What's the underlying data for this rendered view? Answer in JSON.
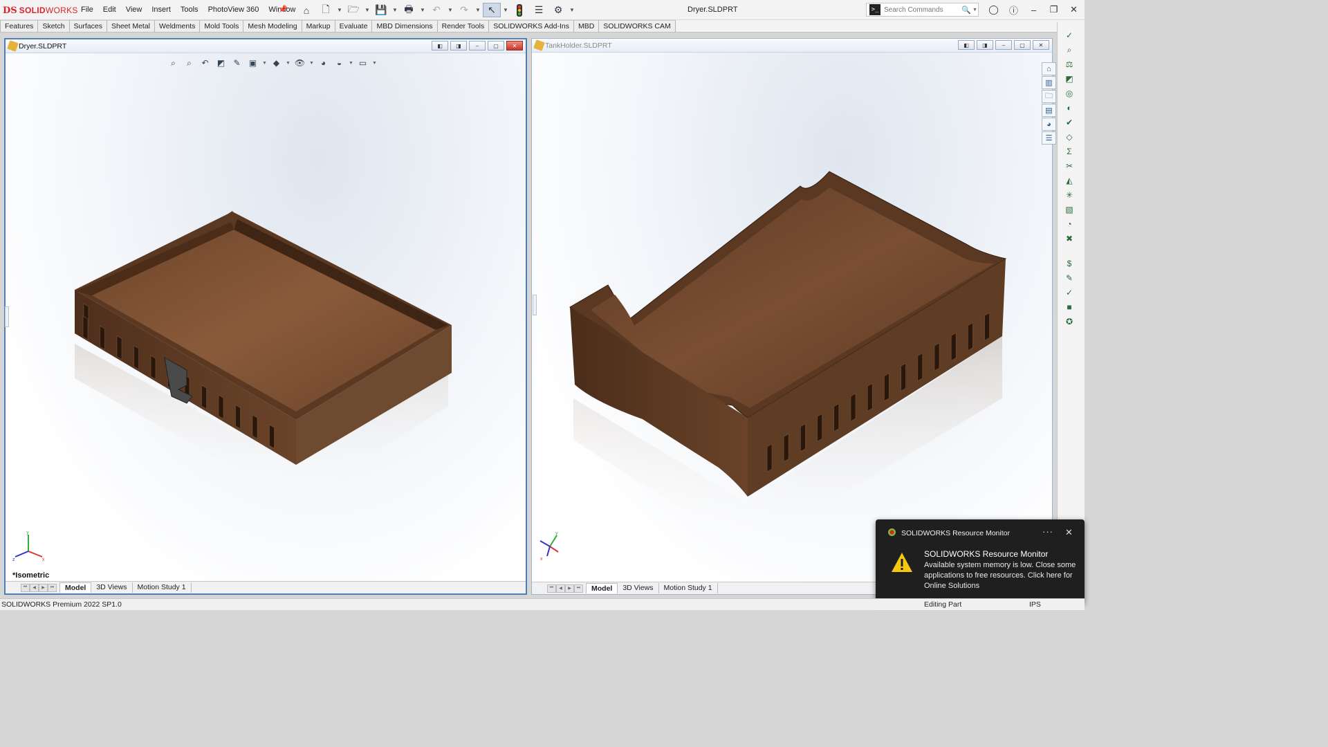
{
  "app": {
    "brand_prefix": "DS",
    "brand_bold": "SOLID",
    "brand_rest": "WORKS",
    "doc_title": "Dryer.SLDPRT"
  },
  "menu": [
    "File",
    "Edit",
    "View",
    "Insert",
    "Tools",
    "PhotoView 360",
    "Window"
  ],
  "quick_access": [
    "home-icon",
    "new-document-icon",
    "open-folder-icon",
    "save-icon",
    "print-icon",
    "undo-icon",
    "redo-icon",
    "select-pointer-icon",
    "rebuild-traffic-light-icon",
    "file-properties-icon",
    "options-gear-icon"
  ],
  "search": {
    "placeholder": "Search Commands",
    "prefix": ">_"
  },
  "command_tabs": [
    "Features",
    "Sketch",
    "Surfaces",
    "Sheet Metal",
    "Weldments",
    "Mold Tools",
    "Mesh Modeling",
    "Markup",
    "Evaluate",
    "MBD Dimensions",
    "Render Tools",
    "SOLIDWORKS Add-Ins",
    "MBD",
    "SOLIDWORKS CAM"
  ],
  "documents": [
    {
      "name": "Dryer.SLDPRT",
      "view_name": "*Isometric",
      "tabs": [
        "Model",
        "3D Views",
        "Motion Study 1"
      ]
    },
    {
      "name": "TankHolder.SLDPRT",
      "view_name": "",
      "tabs": [
        "Model",
        "3D Views",
        "Motion Study 1"
      ]
    }
  ],
  "notification": {
    "app_name": "SOLIDWORKS Resource Monitor",
    "title": "SOLIDWORKS Resource Monitor",
    "body": "Available system memory is low. Close some applications to free resources. Click here for Online Solutions",
    "more": "···",
    "close": "✕"
  },
  "status": {
    "product": "SOLIDWORKS Premium 2022 SP1.0",
    "mode": "Editing Part",
    "units": "IPS"
  },
  "colors": {
    "brand_red": "#d8232a",
    "wood_top": "#7a4f33",
    "wood_side": "#5a3822",
    "active_border": "#4f7fb5"
  }
}
